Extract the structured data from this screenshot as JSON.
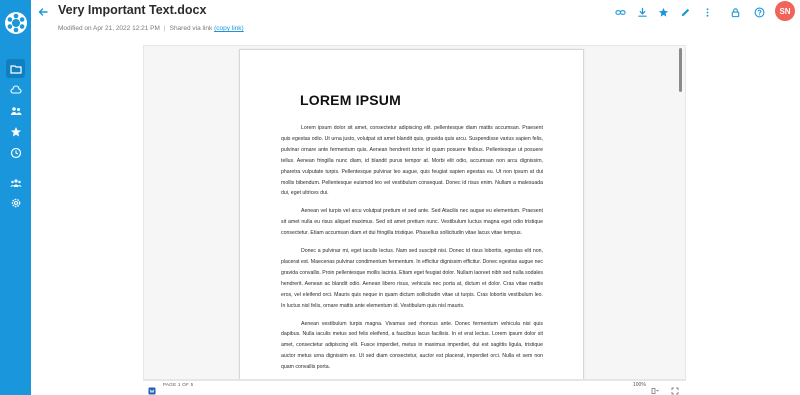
{
  "header": {
    "title": "Very Important Text.docx",
    "modified": "Modified on Apr 21, 2022 12:21 PM",
    "shared": "Shared via link",
    "copy_link": "(copy link)",
    "user_initials": "SN"
  },
  "sidebar": {
    "items": [
      {
        "name": "folder-icon"
      },
      {
        "name": "cloud-icon"
      },
      {
        "name": "users-icon"
      },
      {
        "name": "star-icon"
      },
      {
        "name": "clock-icon"
      },
      {
        "name": "group-icon"
      },
      {
        "name": "settings-icon"
      }
    ]
  },
  "document": {
    "heading": "LOREM IPSUM",
    "paragraphs": [
      "Lorem ipsum dolor sit amet, consectetur adipiscing elit. pellentesque diam mattis accumsan. Praesent quis egestas odio. Ut urna justo, volutpat sit amet blandit quis, gravida quis arcu. Suspendisse varius sapien felis, pulvinar ornare ante fermentum quis. Aenean hendrerit tortor id quam posuere finibus. Pellentesque ut posuere tellus. Aenean fringilla nunc diam, id blandit purus tempor at. Morbi elit odio, accumsan non arcu dignissim, pharetra vulputate turpis. Pellentesque pulvinar leo augue, quis feugiat sapien egestas eu. Ut non ipsum at dui mollis bibendum. Pellentesque euismod leo vel vestibulum consequat. Donec id risus enim. Nullam a malesuada dui, eget ultrices dui.",
      "Aenean vel turpis vel arcu volutpat pretium et sed ante. Sed Atacilis nec augue eu elementum. Praesent sit amet nulla eu risus aliquet maximus. Sed sit amet pretium nunc. Vestibulum luctus magna eget odio tristique consectetur. Etiam accumsan diam et dui fringilla tristique. Phasellus sollicitudin vitae lacus vitae tempus.",
      "Donec a pulvinar mi, eget iaculis lectus. Nam sed suscipit nisi. Donec id risus lobortis, egestas elit non, placerat est. Maecenas pulvinar condimentum fermentum. In efficitur dignissim efficitur. Donec egestas augue nec gravida convallis. Proin pellentesque mollis lacinia. Etiam eget feugiat dolor. Nullam laoreet nibh sed nulla sodales hendrerit. Aenean ac blandit odio. Aenean libero risus, vehicula nec porta at, dictum et dolor. Cras vitae mattis eros, vel eleifend orci. Mauris quis neque in quam dictum sollicitudin vitae ut turpis. Cras lobortis vestibulum leo. In luctus nisl felis, ornare mattis ante elementum id. Vestibulum quis nisl mauris.",
      "Aenean vestibulum turpis magna. Vivamus sed rhoncus ante. Donec fermentum vehicula nisi quis dapibus. Nulla iaculis metus sed felis eleifend, a faucibus lacus facilisis. In et erat lectus. Lorem ipsum dolor sit amet, consectetur adipiscing elit. Fusce imperdiet, metus in maximus imperdiet, dui est sagittis ligula, tristique auctor metus urna dignissim ex. Ut sed diam consectetur, auctor est placerat, imperdiet orci. Nulla et sem non quam convallis porta."
    ]
  },
  "statusbar": {
    "page_indicator": "PAGE 1 OF 5",
    "zoom": "100%"
  },
  "colors": {
    "brand": "#1a97dc",
    "avatar": "#f06459"
  }
}
